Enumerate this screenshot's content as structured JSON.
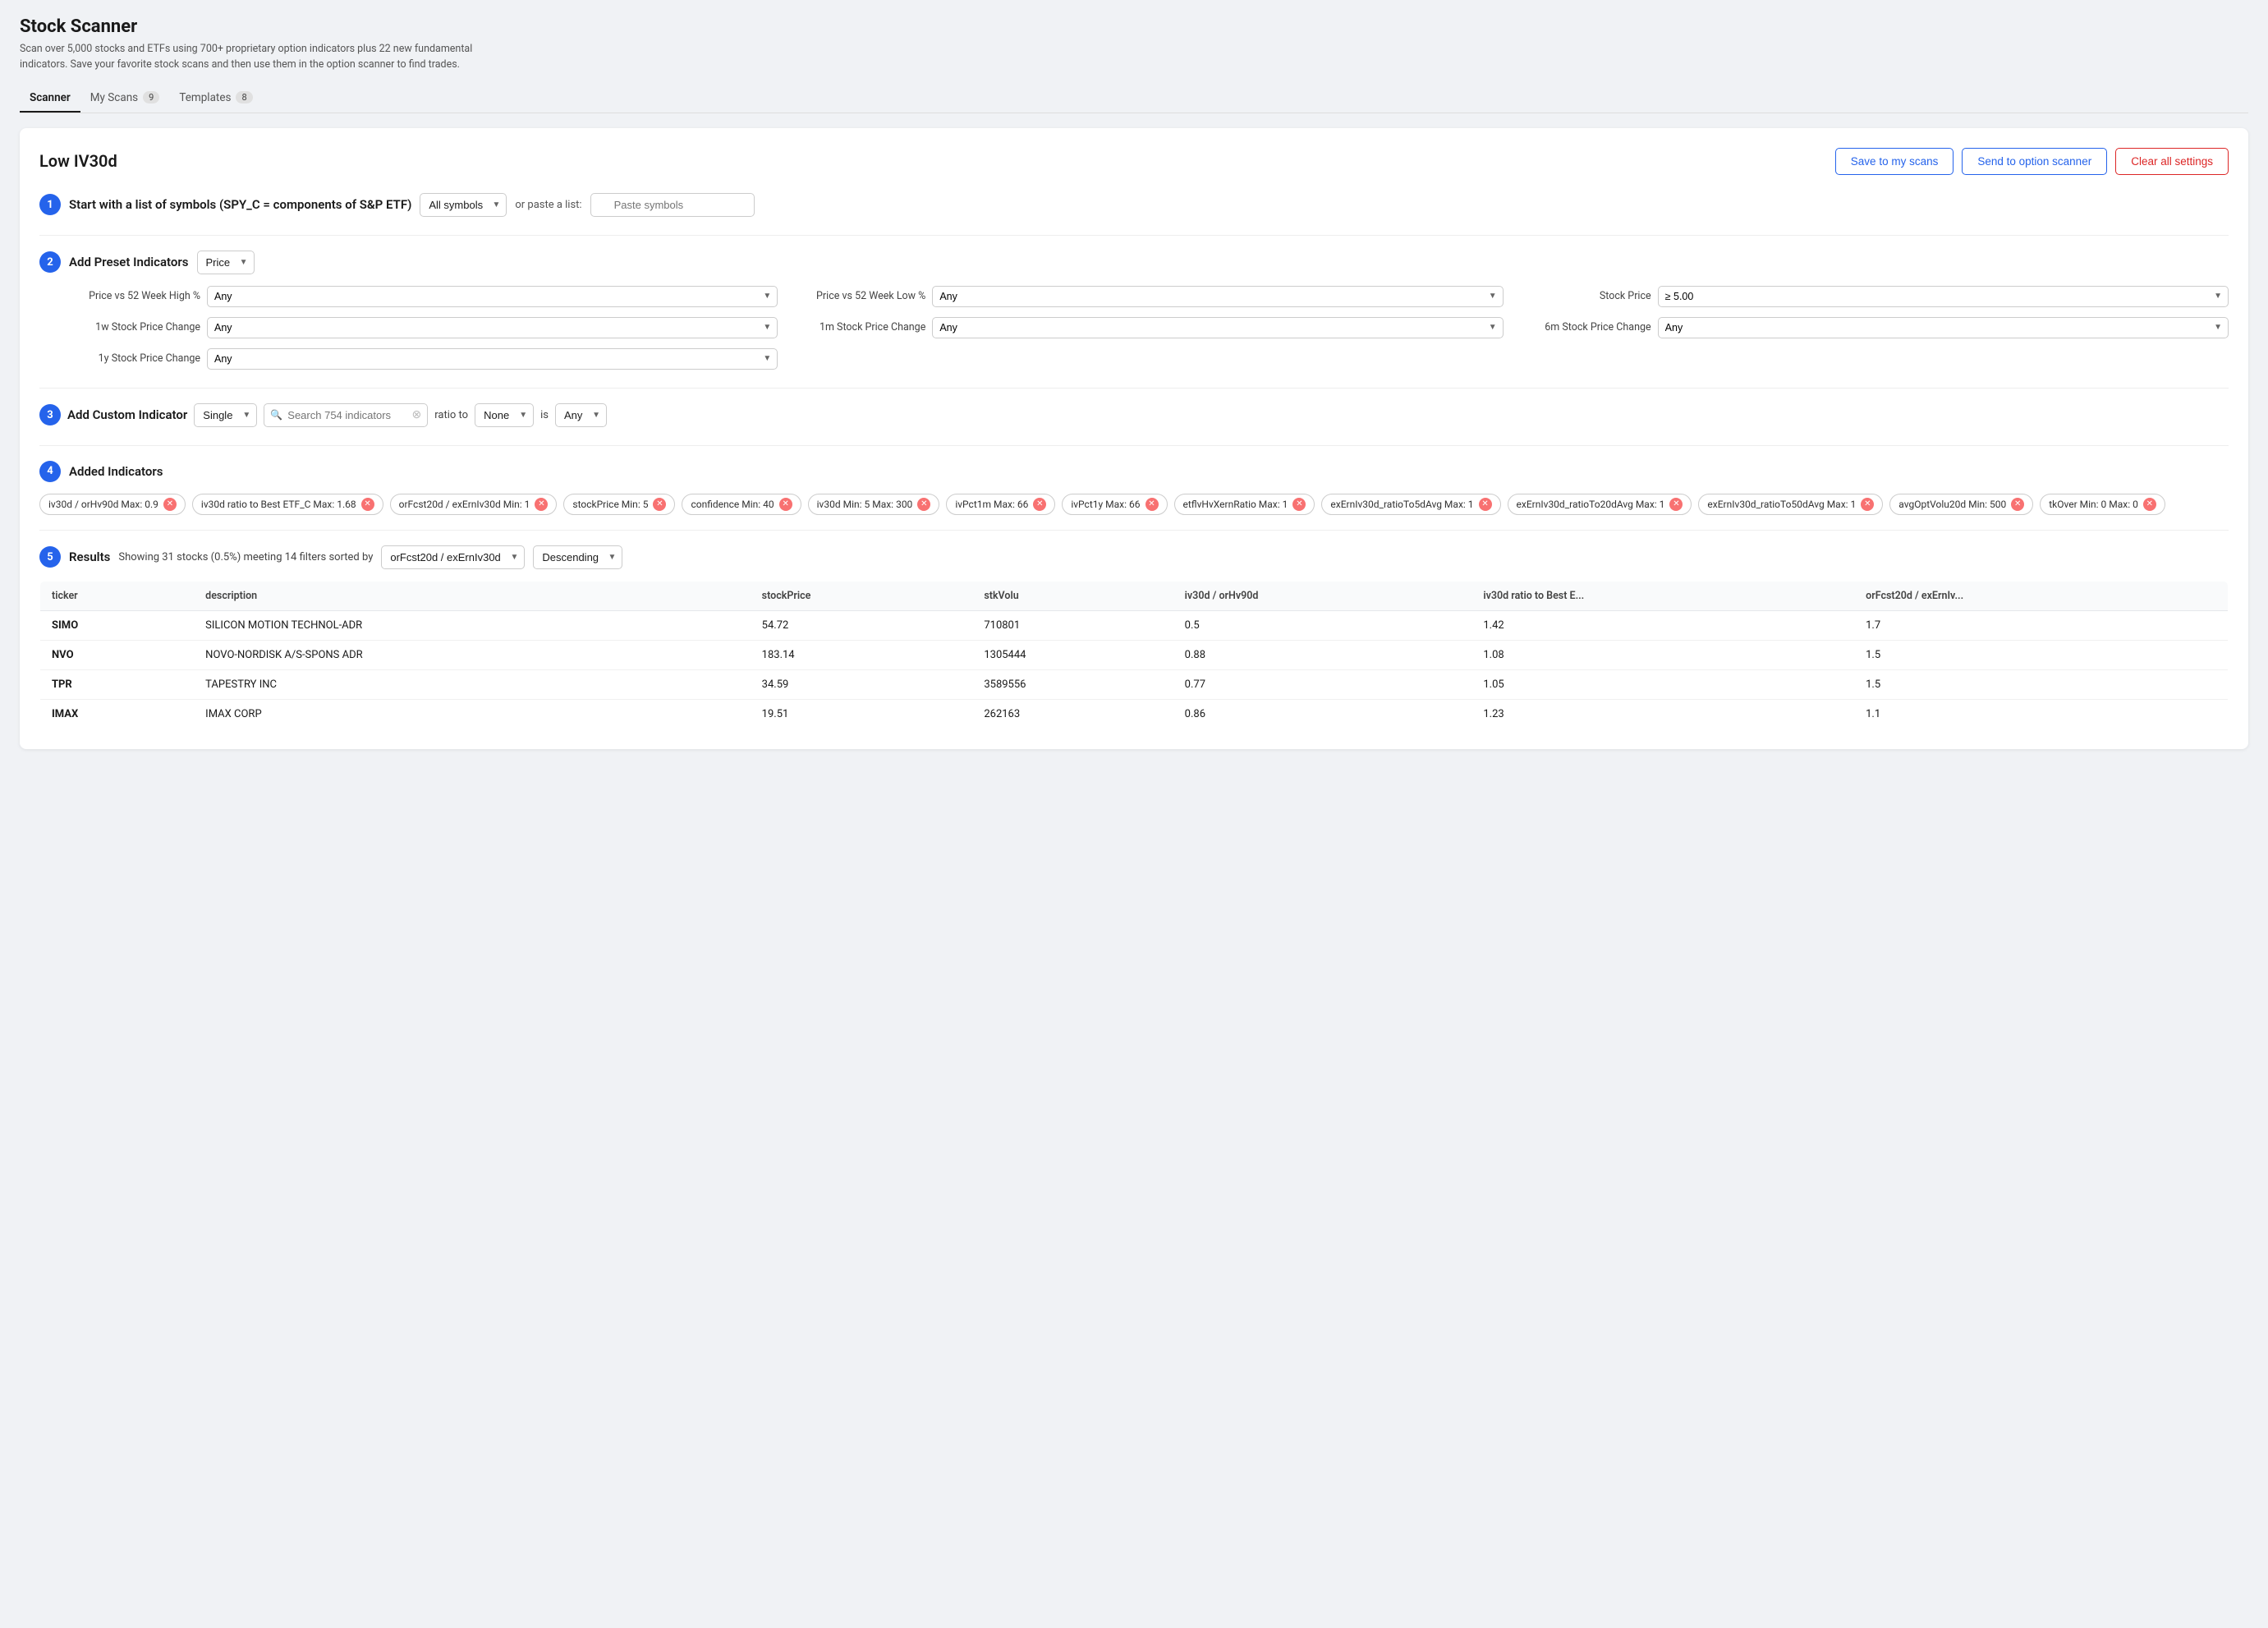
{
  "page": {
    "title": "Stock Scanner",
    "subtitle": "Scan over 5,000 stocks and ETFs using 700+ proprietary option indicators plus 22 new fundamental indicators. Save your favorite stock scans and then use them in the option scanner to find trades."
  },
  "tabs": [
    {
      "label": "Scanner",
      "active": true,
      "badge": null
    },
    {
      "label": "My Scans",
      "active": false,
      "badge": "9"
    },
    {
      "label": "Templates",
      "active": false,
      "badge": "8"
    }
  ],
  "scan": {
    "title": "Low IV30d",
    "actions": {
      "save": "Save to my scans",
      "send": "Send to option scanner",
      "clear": "Clear all settings"
    }
  },
  "step1": {
    "label": "Start with a list of symbols (SPY_C = components of S&P ETF)",
    "symbol_dropdown": "All symbols",
    "or_text": "or paste a list:",
    "paste_placeholder": "Paste symbols"
  },
  "step2": {
    "label": "Add Preset Indicators",
    "preset_dropdown": "Price",
    "indicators": [
      {
        "label": "Price vs 52 Week High %",
        "value": "Any"
      },
      {
        "label": "Price vs 52 Week Low %",
        "value": "Any"
      },
      {
        "label": "Stock Price",
        "value": "≥ 5.00"
      },
      {
        "label": "1w Stock Price Change",
        "value": "Any"
      },
      {
        "label": "1m Stock Price Change",
        "value": "Any"
      },
      {
        "label": "6m Stock Price Change",
        "value": "Any"
      },
      {
        "label": "1y Stock Price Change",
        "value": "Any"
      }
    ]
  },
  "step3": {
    "label": "Add Custom Indicator",
    "mode_dropdown": "Single",
    "search_placeholder": "Search 754 indicators",
    "ratio_label": "ratio to",
    "ratio_dropdown": "None",
    "is_label": "is",
    "is_dropdown": "Any"
  },
  "step4": {
    "label": "Added Indicators",
    "tags": [
      "iv30d / orHv90d  Max: 0.9",
      "iv30d ratio to Best ETF_C  Max: 1.68",
      "orFcst20d / exErnIv30d  Min: 1",
      "stockPrice  Min: 5",
      "confidence  Min: 40",
      "iv30d  Min: 5  Max: 300",
      "ivPct1m  Max: 66",
      "ivPct1y  Max: 66",
      "etflvHvXernRatio  Max: 1",
      "exErnIv30d_ratioTo5dAvg  Max: 1",
      "exErnIv30d_ratioTo20dAvg  Max: 1",
      "exErnIv30d_ratioTo50dAvg  Max: 1",
      "avgOptVolu20d  Min: 500",
      "tkOver  Min: 0  Max: 0"
    ]
  },
  "step5": {
    "label": "Results",
    "info": "Showing 31 stocks (0.5%) meeting 14 filters sorted by",
    "sort_field": "orFcst20d / exErnIv30d",
    "sort_direction": "Descending",
    "columns": [
      "ticker",
      "description",
      "stockPrice",
      "stkVolu",
      "iv30d / orHv90d",
      "iv30d ratio to Best E...",
      "orFcst20d / exErnIv..."
    ],
    "rows": [
      {
        "ticker": "SIMO",
        "description": "SILICON MOTION TECHNOL-ADR",
        "stockPrice": "54.72",
        "stkVolu": "710801",
        "iv30d_orHv90d": "0.5",
        "iv30d_ratio": "1.42",
        "orFcst20d": "1.7"
      },
      {
        "ticker": "NVO",
        "description": "NOVO-NORDISK A/S-SPONS ADR",
        "stockPrice": "183.14",
        "stkVolu": "1305444",
        "iv30d_orHv90d": "0.88",
        "iv30d_ratio": "1.08",
        "orFcst20d": "1.5"
      },
      {
        "ticker": "TPR",
        "description": "TAPESTRY INC",
        "stockPrice": "34.59",
        "stkVolu": "3589556",
        "iv30d_orHv90d": "0.77",
        "iv30d_ratio": "1.05",
        "orFcst20d": "1.5"
      },
      {
        "ticker": "IMAX",
        "description": "IMAX CORP",
        "stockPrice": "19.51",
        "stkVolu": "262163",
        "iv30d_orHv90d": "0.86",
        "iv30d_ratio": "1.23",
        "orFcst20d": "1.1"
      }
    ]
  }
}
